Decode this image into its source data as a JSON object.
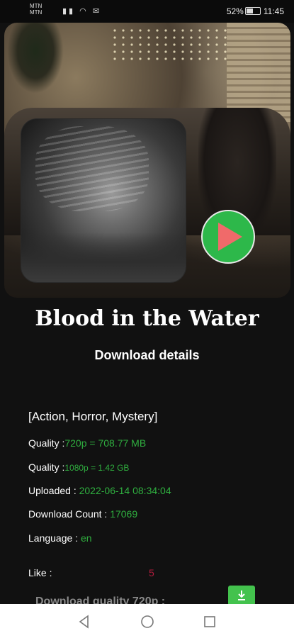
{
  "status_bar": {
    "carrier1": "MTN",
    "carrier2": "MTN",
    "battery": "52%",
    "time": "11:45"
  },
  "movie": {
    "title": "Blood in the Water",
    "section_heading": "Download details",
    "genres": "[Action, Horror, Mystery]",
    "quality1_label": "Quality :",
    "quality1_value": "720p = 708.77 MB",
    "quality2_label": "Quality :",
    "quality2_value": "1080p = 1.42 GB",
    "uploaded_label": "Uploaded : ",
    "uploaded_value": "2022-06-14 08:34:04",
    "download_count_label": "Download Count : ",
    "download_count_value": "17069",
    "language_label": "Language : ",
    "language_value": "en",
    "like_label": "Like :",
    "like_count": "5",
    "download_quality_label": "Download quality 720p :"
  },
  "colors": {
    "accent_green": "#2fae3f",
    "like_red": "#b01c3c",
    "play_button": "#2db84a"
  },
  "icons": [
    "play-icon",
    "download-icon",
    "back-icon",
    "home-icon",
    "recents-icon"
  ]
}
